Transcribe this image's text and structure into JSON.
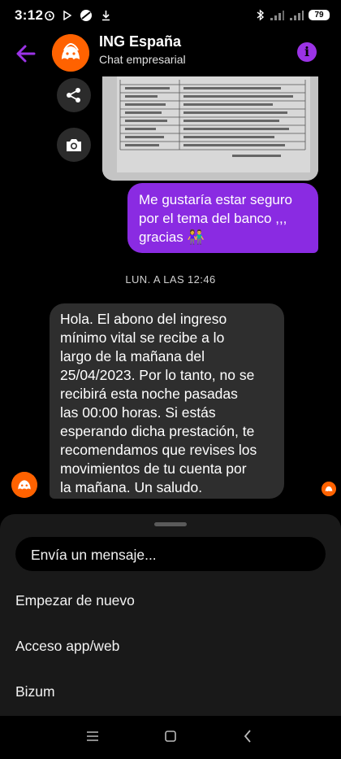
{
  "status_bar": {
    "time": "3:12",
    "battery": "79"
  },
  "header": {
    "title": "ING España",
    "subtitle": "Chat empresarial"
  },
  "messages": {
    "sent": "Me gustaría estar seguro por el tema del banco ,,, gracias 👫",
    "sent_lines": [
      "Me gustaría estar seguro",
      "por el tema del banco ,,,",
      "gracias 👫"
    ],
    "timestamp": "LUN. A LAS 12:46",
    "received_lines": [
      "Hola. El abono del ingreso",
      "mínimo vital se recibe a lo",
      "largo de la mañana del",
      "25/04/2023. Por lo tanto, no se",
      "recibirá esta noche pasadas",
      "las 00:00 horas. Si estás",
      "esperando dicha prestación, te",
      "recomendamos que revises los",
      "movimientos de tu cuenta por",
      "la mañana. Un saludo."
    ]
  },
  "composer": {
    "placeholder": "Envía un mensaje..."
  },
  "quick_replies": [
    "Empezar de nuevo",
    "Acceso app/web",
    "Bizum"
  ],
  "colors": {
    "accent": "#8a2be2",
    "brand": "#ff6200",
    "received_bubble": "#2e2e2e"
  }
}
